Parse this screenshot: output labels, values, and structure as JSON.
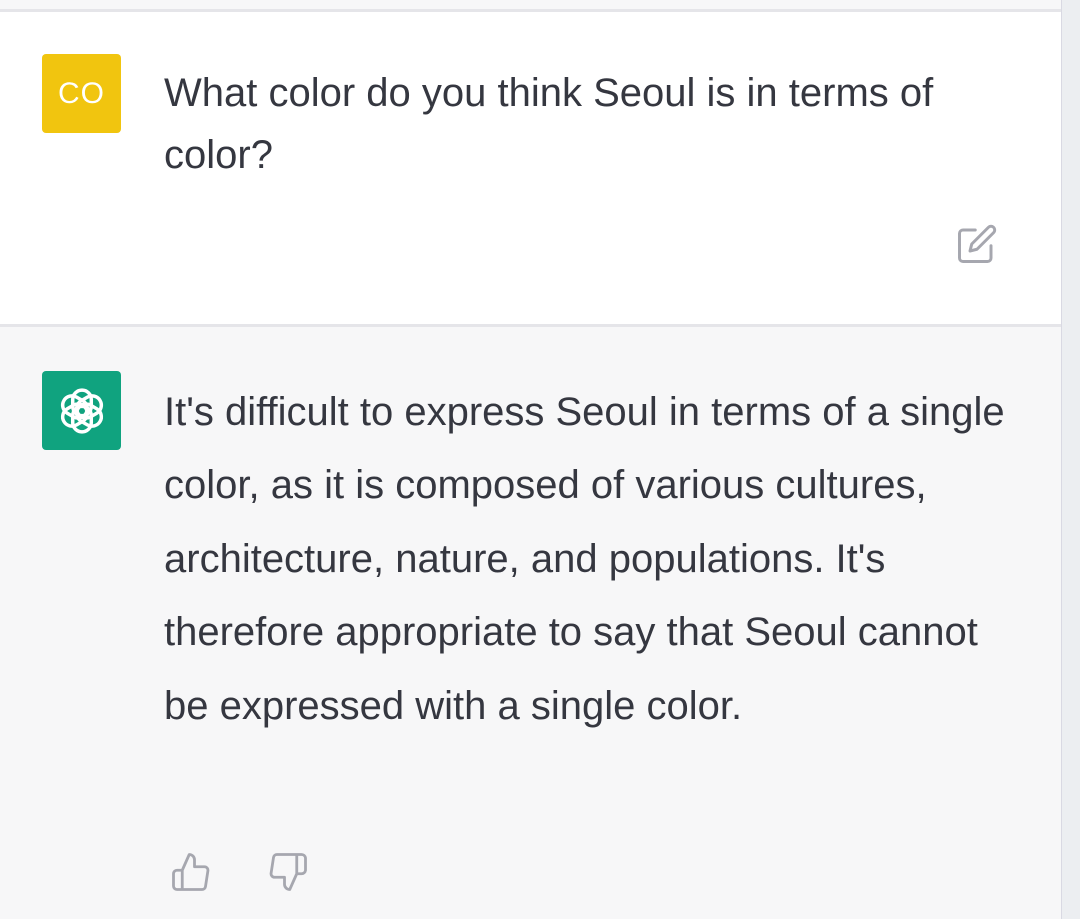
{
  "user_message": {
    "avatar_initials": "CO",
    "avatar_color": "#f1c50f",
    "text": "What color do you think Seoul is in terms of color?",
    "edit_icon": "edit-icon"
  },
  "assistant_message": {
    "avatar_icon": "openai-logo-icon",
    "avatar_color": "#10a37f",
    "text": "It's difficult to express Seoul in terms of a single color, as it is composed of various cultures, architecture, nature, and populations. It's therefore appropriate to say that Seoul cannot be expressed with a single color.",
    "feedback_icons": [
      "thumbs-up-icon",
      "thumbs-down-icon"
    ]
  }
}
